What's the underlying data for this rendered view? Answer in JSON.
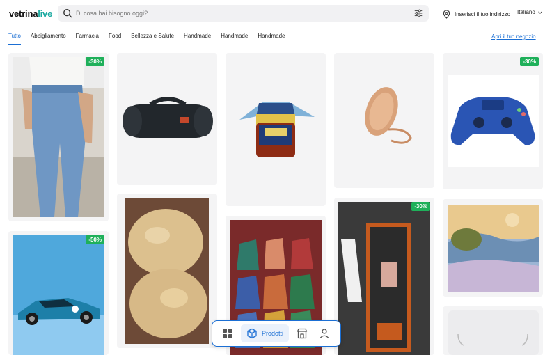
{
  "header": {
    "logo_main": "vetrina",
    "logo_accent": "live",
    "search_placeholder": "Di cosa hai bisogno oggi?",
    "address_link": "Inserisci il tuo indirizzo",
    "language": "Italiano"
  },
  "categories": {
    "items": [
      "Tutto",
      "Abbigliamento",
      "Farmacia",
      "Food",
      "Bellezza e Salute",
      "Handmade",
      "Handmade",
      "Handmade"
    ],
    "active_index": 0,
    "open_store_link": "Apri il tuo negozio"
  },
  "products": [
    {
      "badge": "-30%"
    },
    {
      "badge": ""
    },
    {
      "badge": ""
    },
    {
      "badge": ""
    },
    {
      "badge": "-30%"
    },
    {
      "badge": "-50%"
    },
    {
      "badge": ""
    },
    {
      "badge": ""
    },
    {
      "badge": "-30%"
    },
    {
      "badge": ""
    },
    {
      "badge": ""
    }
  ],
  "bottom_nav": {
    "items": [
      "grid-icon",
      "box-icon",
      "store-icon",
      "user-icon"
    ],
    "active_label": "Prodotti"
  },
  "colors": {
    "accent_blue": "#1b6fd4",
    "logo_teal": "#1aa9a0",
    "discount_green": "#1fb05a"
  }
}
